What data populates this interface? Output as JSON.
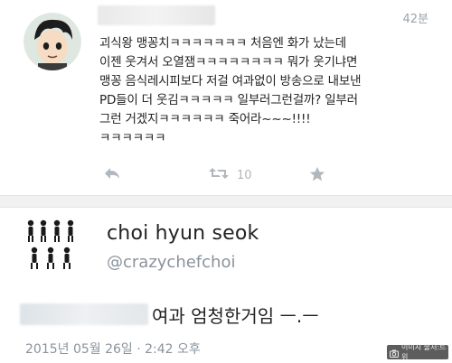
{
  "tweet": {
    "time_ago": "42분",
    "body": "괴식왕 맹꽁치ㅋㅋㅋㅋㅋㅋㅋ 처음엔 화가 났는데\n이젠 웃겨서 오열잼ㅋㅋㅋㅋㅋㅋㅋㅋ 뭐가 웃기냐면\n맹꽁 음식레시피보다 저걸 여과없이 방송으로 내보낸\nPD들이 더 웃김ㅋㅋㅋㅋㅋ 일부러그런걸까? 일부러\n그런 거겠지ㅋㅋㅋㅋㅋㅋ 죽어라~~~!!!!\nㅋㅋㅋㅋㅋㅋ",
    "retweet_count": "10",
    "icons": {
      "reply": "reply-icon",
      "retweet": "retweet-icon",
      "favorite": "star-icon"
    }
  },
  "profile": {
    "display_name": "choi hyun seok",
    "handle": "@crazychefchoi"
  },
  "reply": {
    "text": "여과 엄청한거임 ㅡ.ㅡ",
    "datetime": "2015년 05월 26일 · 2:42 오후"
  },
  "watermark": {
    "icon": "camera-icon",
    "text": "이미지 출처:트위"
  },
  "colors": {
    "muted": "#8a939b",
    "icon": "#b1b7bd",
    "band": "#f1f1f1"
  }
}
